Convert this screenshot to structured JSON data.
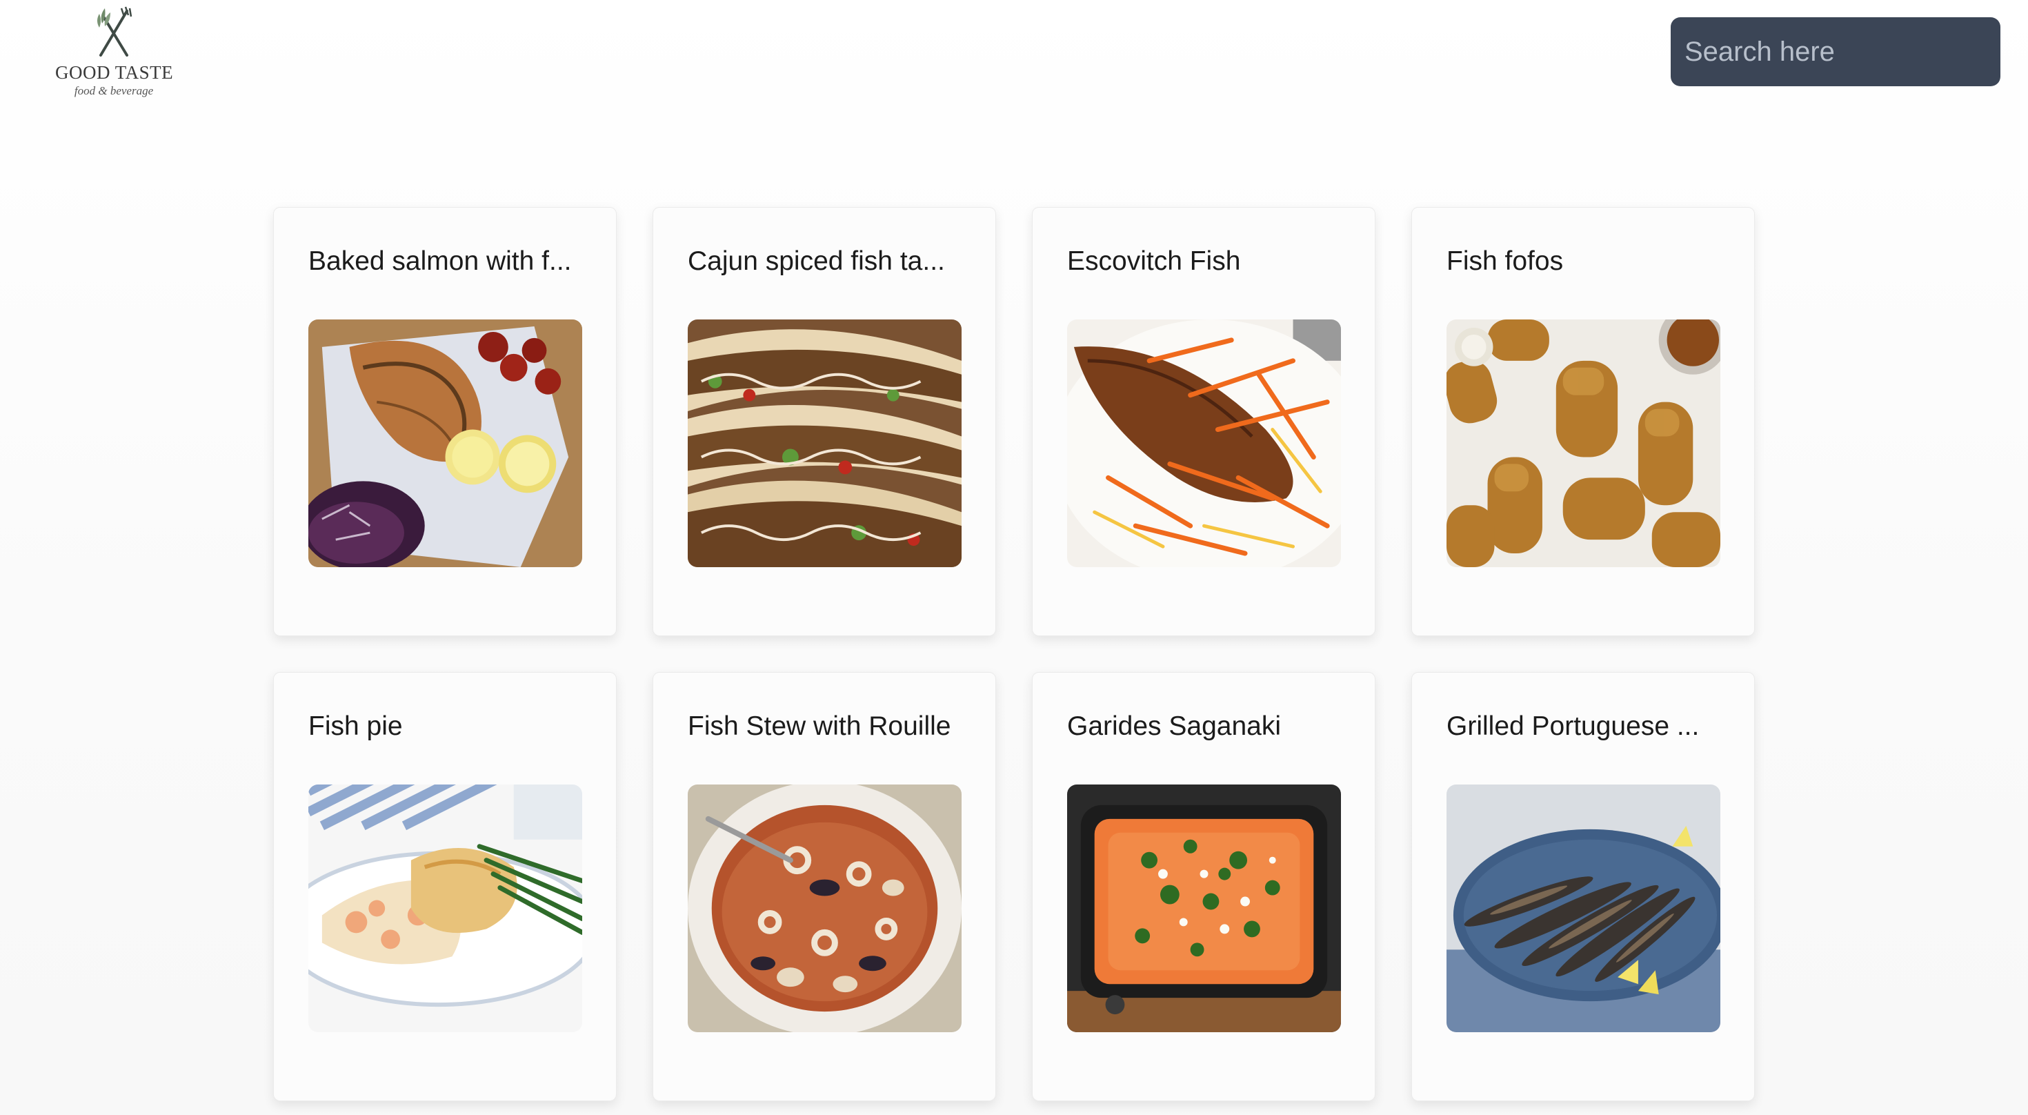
{
  "header": {
    "logo_title": "GOOD TASTE",
    "logo_subtitle": "food & beverage",
    "logo_icon": "fork-knife-herb-icon",
    "search_placeholder": "Search here"
  },
  "colors": {
    "search_bg": "#3b4556",
    "card_bg": "#fcfcfc"
  },
  "recipes": [
    {
      "title": "Baked salmon with f...",
      "image": "baked-salmon-photo"
    },
    {
      "title": "Cajun spiced fish ta...",
      "image": "cajun-fish-tacos-photo"
    },
    {
      "title": "Escovitch Fish",
      "image": "escovitch-fish-photo"
    },
    {
      "title": "Fish fofos",
      "image": "fish-fofos-photo"
    },
    {
      "title": "Fish pie",
      "image": "fish-pie-photo"
    },
    {
      "title": "Fish Stew with Rouille",
      "image": "fish-stew-photo"
    },
    {
      "title": "Garides Saganaki",
      "image": "garides-saganaki-photo"
    },
    {
      "title": "Grilled Portuguese ...",
      "image": "grilled-portuguese-sardines-photo"
    }
  ]
}
